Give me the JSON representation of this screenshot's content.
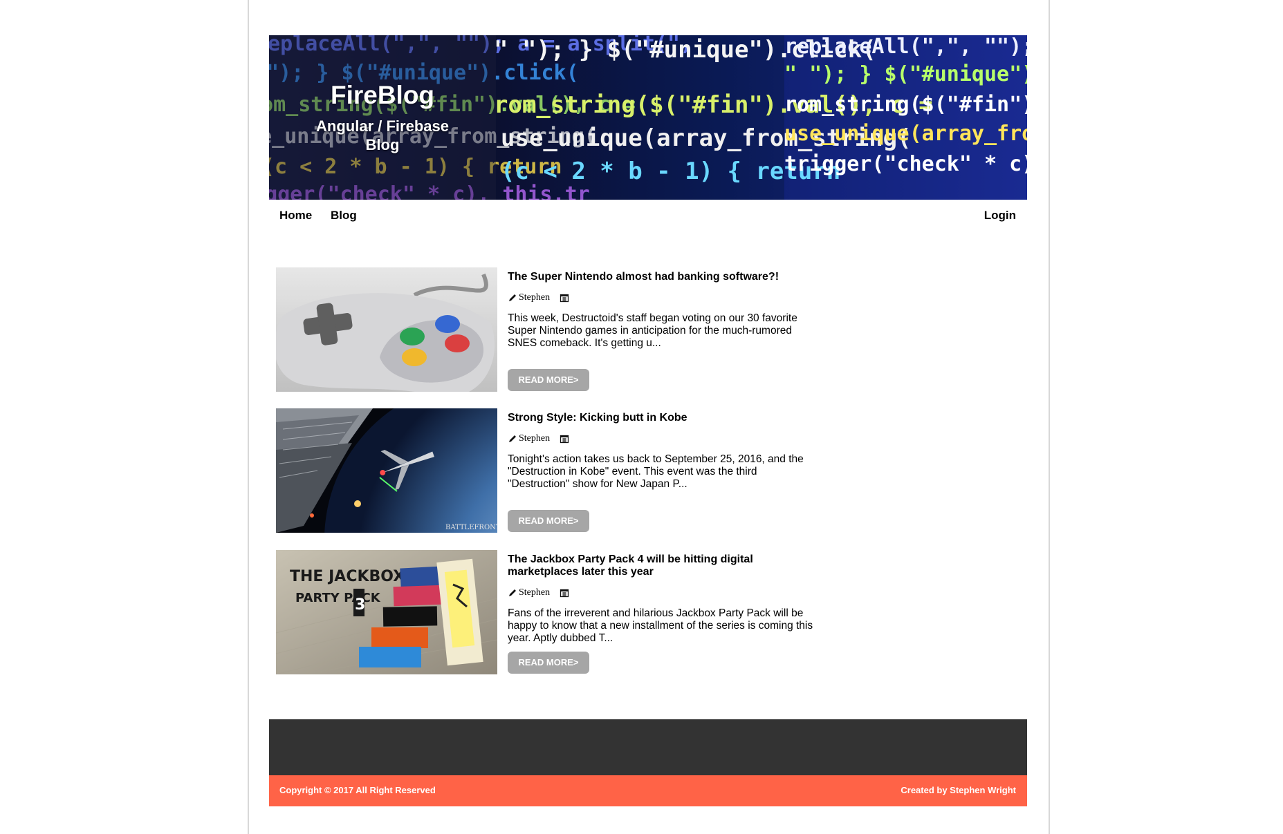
{
  "header": {
    "title": "FireBlog",
    "subtitle": "Angular / Firebase Blog",
    "banner_code_lines": [
      "replaceAll(\",\", \"\"); a = a.split(\",",
      "\" \"); } $(\"#unique\").click(",
      "rom_string($(\"#fin\").val(), c =",
      "use_unique(array_from_string(",
      "(c < 2 * b - 1) { return",
      "trigger(\"check\" * c), this.tr"
    ]
  },
  "nav": {
    "home": "Home",
    "blog": "Blog",
    "login": "Login"
  },
  "posts": [
    {
      "title": "The Super Nintendo almost had banking software?!",
      "author": "Stephen",
      "excerpt": "This week, Destructoid's staff began voting on our 30 favorite Super Nintendo games in anticipation for the much-rumored SNES comeback. It's getting u...",
      "read_more": "READ MORE>",
      "image": "snes-controller"
    },
    {
      "title": "Strong Style: Kicking butt in Kobe",
      "author": "Stephen",
      "excerpt": "Tonight's action takes us back to September 25, 2016, and the \"Destruction in Kobe\" event. This event was the third \"Destruction\" show for New Japan P...",
      "read_more": "READ MORE>",
      "image": "space-battle",
      "image_caption": "BATTLEFRONT II"
    },
    {
      "title": "The Jackbox Party Pack 4 will be hitting digital marketplaces later this year",
      "author": "Stephen",
      "excerpt": "Fans of the irreverent and hilarious Jackbox Party Pack will be happy to know that a new installment of the series is coming this year. Aptly dubbed T...",
      "read_more": "READ MORE>",
      "image": "jackbox-party-pack",
      "image_caption_top": "THE JACKBOX",
      "image_caption_bottom": "PARTY PACK",
      "image_caption_num": "3"
    }
  ],
  "footer": {
    "copyright": "Copyright © 2017 All Right Reserved",
    "credit": "Created by Stephen Wright"
  },
  "colors": {
    "footer_dark": "#333333",
    "footer_accent": "#ff6347",
    "button": "#a6a6a6"
  }
}
